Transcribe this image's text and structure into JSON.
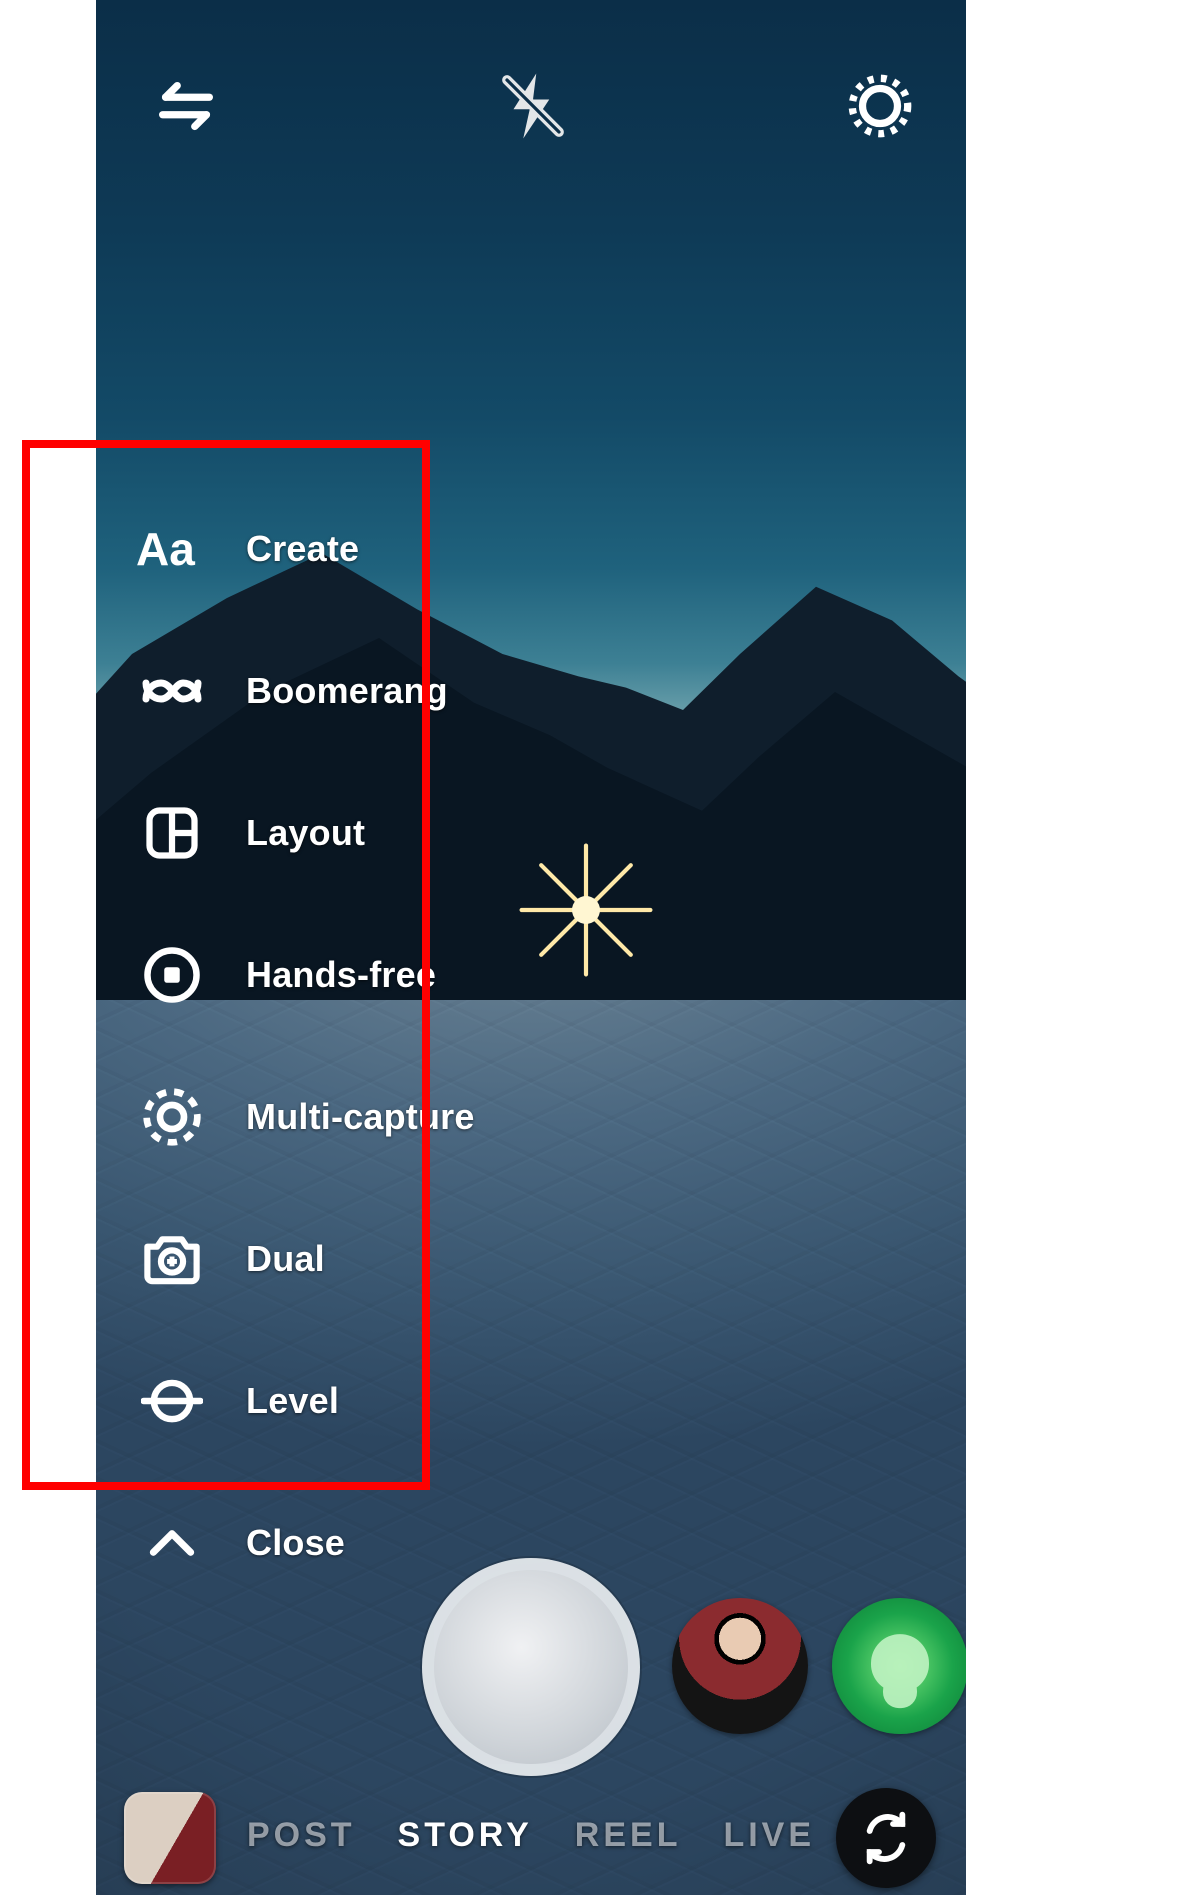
{
  "topbar": {
    "switch_icon": "switch-camera",
    "flash_icon": "flash-off",
    "settings_icon": "settings"
  },
  "tools": {
    "items": [
      {
        "id": "create",
        "label": "Create",
        "icon": "text-aa"
      },
      {
        "id": "boomerang",
        "label": "Boomerang",
        "icon": "infinity"
      },
      {
        "id": "layout",
        "label": "Layout",
        "icon": "layout-grid"
      },
      {
        "id": "hands-free",
        "label": "Hands-free",
        "icon": "record-dot"
      },
      {
        "id": "multi-capture",
        "label": "Multi-capture",
        "icon": "dashed-circle"
      },
      {
        "id": "dual",
        "label": "Dual",
        "icon": "camera-plus"
      },
      {
        "id": "level",
        "label": "Level",
        "icon": "level-line"
      }
    ],
    "close_label": "Close"
  },
  "modes": {
    "items": [
      {
        "id": "post",
        "label": "POST",
        "active": false
      },
      {
        "id": "story",
        "label": "STORY",
        "active": true
      },
      {
        "id": "reel",
        "label": "REEL",
        "active": false
      },
      {
        "id": "live",
        "label": "LIVE",
        "active": false
      }
    ]
  },
  "bottom": {
    "shutter": "capture",
    "filter_photo": "effect-preset-1",
    "filter_green": "effect-preset-2",
    "gallery": "gallery-last-photo",
    "flip": "flip-camera"
  },
  "annotation": {
    "highlight_box": "tools-menu-highlight"
  }
}
